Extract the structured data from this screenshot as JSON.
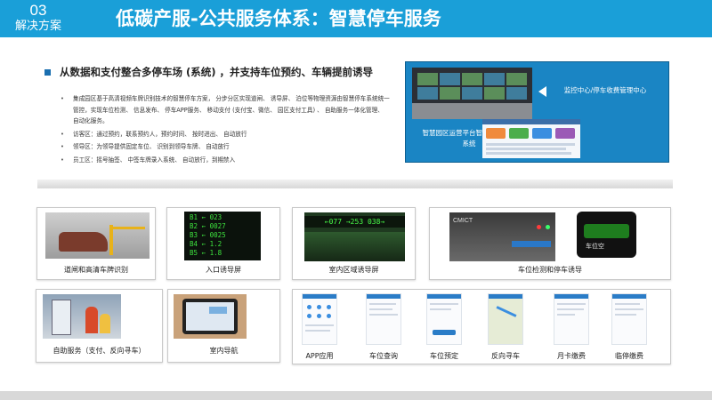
{
  "header": {
    "section_number": "03",
    "section_label": "解决方案",
    "title": "低碳产服-公共服务体系：智慧停车服务"
  },
  "intro": {
    "heading": "从数据和支付整合多停车场 (系统) ，并支持车位预约、车辆提前诱导",
    "bullets": [
      "集成园区基于高清视频车牌识别技术的智慧停车方案， 分步分区实现道闸、 诱导屏、 泊位等物理资源由智慧停车系统统一管控，实现车位检测、 信息发布、 停车APP服务、 移动支付 (支付宝、微信、 园区支付工具) 、 自助服务一体化管理、 自动化服务。",
      "访客区：通过预约，联系预约人，预约时间、 按时进出、 自动放行",
      "领导区：为领导提供固定车位、 识别到领导车牌、 自动放行",
      "员工区：摇号抽签、 中签车牌录入系统、 自动放行，到期禁入"
    ]
  },
  "panel": {
    "text_monitor": "监控中心/停车收费管理中心",
    "text_platform": "智慧园区运营平台智慧停车管理系统",
    "color": "#1a85c4"
  },
  "cards": {
    "gate": "道闸和高清车牌识别",
    "entrance": "入口诱导屏",
    "indoor": "室内区域诱导屏",
    "detection": "车位检测和停车诱导",
    "selfservice": "自助服务（支付、反向寻车）",
    "navigation": "室内导航"
  },
  "led_rows": [
    "B1 ← 023",
    "B2 ← 0027",
    "B3 ← 0025",
    "B4 ← 1.2",
    "B5 ← 1.8"
  ],
  "indoor_sign_text": "←077 →253 038→",
  "app_labels": [
    "APP应用",
    "车位查询",
    "车位预定",
    "反向寻车",
    "月卡缴费",
    "临停缴费"
  ],
  "colors": {
    "brand": "#1a9fd8",
    "dark_blue": "#1a6fb0",
    "led_green": "#3ee33e"
  }
}
